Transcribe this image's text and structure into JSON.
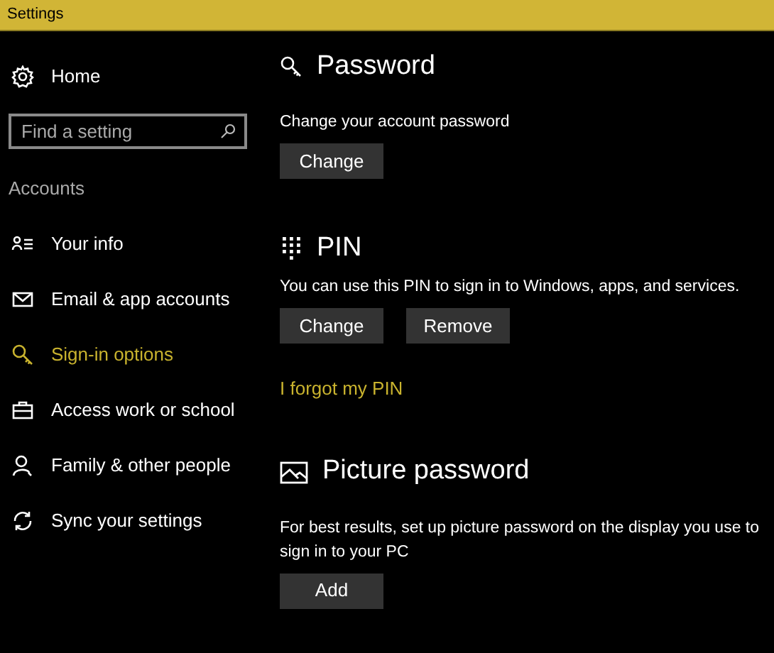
{
  "window": {
    "title": "Settings"
  },
  "sidebar": {
    "home": {
      "label": "Home"
    },
    "search": {
      "placeholder": "Find a setting"
    },
    "section": "Accounts",
    "items": [
      {
        "kind": "info",
        "label": "Your info",
        "selected": false
      },
      {
        "kind": "mail",
        "label": "Email & app accounts",
        "selected": false
      },
      {
        "kind": "key",
        "label": "Sign-in options",
        "selected": true
      },
      {
        "kind": "briefcase",
        "label": "Access work or school",
        "selected": false
      },
      {
        "kind": "person",
        "label": "Family & other people",
        "selected": false
      },
      {
        "kind": "sync",
        "label": "Sync your settings",
        "selected": false
      }
    ]
  },
  "sections": [
    {
      "kind": "key",
      "title": "Password",
      "description": "Change your account password",
      "buttons": [
        "Change"
      ]
    },
    {
      "kind": "pin",
      "title": "PIN",
      "description": "You can use this PIN to sign in to Windows, apps, and services.",
      "buttons": [
        "Change",
        "Remove"
      ],
      "link": "I forgot my PIN"
    },
    {
      "kind": "picture",
      "title": "Picture password",
      "description": "For best results, set up picture password on the display you use to sign in to your PC",
      "buttons": [
        "Add"
      ]
    }
  ]
}
